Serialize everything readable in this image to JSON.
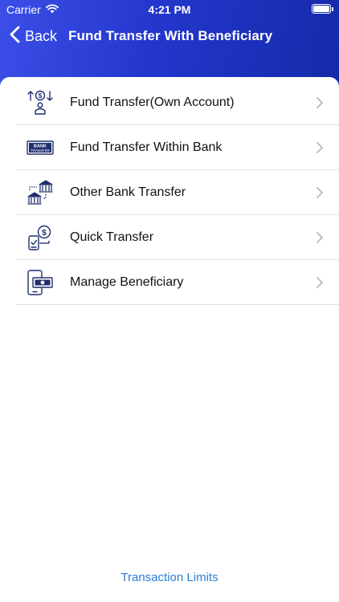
{
  "status_bar": {
    "carrier": "Carrier",
    "time": "4:21 PM"
  },
  "nav": {
    "back_label": "Back",
    "title": "Fund Transfer With Beneficiary"
  },
  "menu": {
    "items": [
      {
        "label": "Fund Transfer(Own Account)",
        "icon": "own-account-transfer-icon"
      },
      {
        "label": "Fund Transfer Within Bank",
        "icon": "bank-transfer-icon"
      },
      {
        "label": "Other Bank Transfer",
        "icon": "other-bank-icon"
      },
      {
        "label": "Quick Transfer",
        "icon": "quick-transfer-icon"
      },
      {
        "label": "Manage Beneficiary",
        "icon": "manage-beneficiary-icon"
      }
    ]
  },
  "bank_icon_text": "BANK TRANSFER",
  "footer": {
    "link_label": "Transaction Limits"
  },
  "colors": {
    "header_start": "#3b4fe8",
    "header_end": "#142aa8",
    "icon_navy": "#1f2f6e",
    "link": "#2a7fd4"
  }
}
